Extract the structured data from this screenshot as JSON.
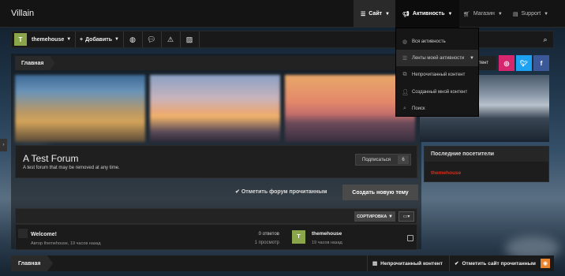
{
  "topnav": {
    "logo": "Villain",
    "items": [
      {
        "label": "Сайт",
        "icon": "list-icon"
      },
      {
        "label": "Активность",
        "icon": "megaphone-icon"
      },
      {
        "label": "Магазин",
        "icon": "cart-icon"
      },
      {
        "label": "Support",
        "icon": "document-icon"
      }
    ]
  },
  "dropdown": {
    "items": [
      {
        "label": "Вся активность",
        "icon": "globe-icon"
      },
      {
        "label": "Ленты моей активности",
        "icon": "list-icon"
      },
      {
        "label": "Непрочитанный контент",
        "icon": "copy-icon"
      },
      {
        "label": "Созданный мной контент",
        "icon": "user-plus-icon"
      },
      {
        "label": "Поиск",
        "icon": "search-icon"
      }
    ]
  },
  "userbar": {
    "avatar_letter": "T",
    "username": "themehouse",
    "add_label": "Добавить"
  },
  "breadcrumb": {
    "home": "Главная",
    "tail": "тент"
  },
  "forum": {
    "title": "A Test Forum",
    "description": "A test forum that may be removed at any time.",
    "subscribe_label": "Подписаться",
    "subscribe_count": "6",
    "mark_read_label": "Отметить форум прочитанным",
    "new_topic_label": "Создать новую тему"
  },
  "threadlist": {
    "sort_label": "СОРТИРОВКА",
    "threads": [
      {
        "title": "Welcome!",
        "meta": "Автор themehouse, 19 часов назад",
        "replies": "0 ответов",
        "views": "1 просмотр",
        "last_avatar": "T",
        "last_user": "themehouse",
        "last_time": "19 часов назад"
      }
    ]
  },
  "sidebar": {
    "recent_visitors_title": "Последние посетители",
    "visitors": [
      "themehouse"
    ]
  },
  "footer": {
    "home": "Главная",
    "unread_label": "Непрочитанный контент",
    "mark_site_read_label": "Отметить сайт прочитанным"
  },
  "colors": {
    "accent_green": "#8ba54a",
    "instagram": "#d6276e",
    "twitter": "#1da1f2",
    "facebook": "#3b5998",
    "username_red": "#d03020",
    "rss_orange": "#e8842c"
  }
}
